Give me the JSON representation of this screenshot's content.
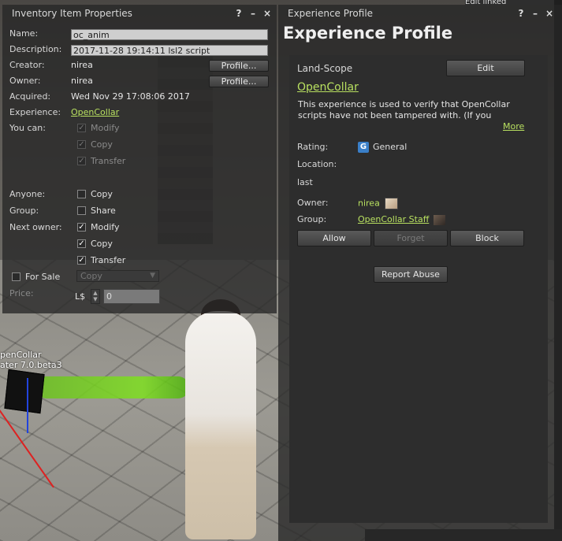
{
  "world": {
    "label_line1": "penCollar",
    "label_line2": "ater 7.0.beta3",
    "top_right_text": "Edit linked"
  },
  "inventory": {
    "title": "Inventory Item Properties",
    "title_buttons": [
      "?",
      "–",
      "×"
    ],
    "name_label": "Name:",
    "name_value": "oc_anim",
    "description_label": "Description:",
    "description_value": "2017-11-28 19:14:11 lsl2 script",
    "creator_label": "Creator:",
    "creator_value": "nirea",
    "creator_profile_btn": "Profile...",
    "owner_label": "Owner:",
    "owner_value": "nirea",
    "owner_profile_btn": "Profile...",
    "acquired_label": "Acquired:",
    "acquired_value": "Wed Nov 29 17:08:06 2017",
    "experience_label": "Experience:",
    "experience_value": "OpenCollar",
    "you_can_label": "You can:",
    "you_can": [
      {
        "label": "Modify",
        "checked": true
      },
      {
        "label": "Copy",
        "checked": true
      },
      {
        "label": "Transfer",
        "checked": true
      }
    ],
    "anyone_label": "Anyone:",
    "anyone_copy": "Copy",
    "group_label": "Group:",
    "group_share": "Share",
    "next_owner_label": "Next owner:",
    "next_owner": [
      {
        "label": "Modify",
        "checked": true
      },
      {
        "label": "Copy",
        "checked": true
      },
      {
        "label": "Transfer",
        "checked": true
      }
    ],
    "for_sale_label": "For Sale",
    "sale_type": "Copy",
    "price_label": "Price:",
    "currency": "L$",
    "price_value": "0"
  },
  "experience": {
    "title": "Experience Profile",
    "title_buttons": [
      "?",
      "–",
      "×"
    ],
    "heading": "Experience Profile",
    "scope": "Land-Scope",
    "edit_btn": "Edit",
    "name": "OpenCollar",
    "description": "This experience is used to verify that OpenCollar scripts have not been tampered with.  (If you",
    "more_link": "More",
    "rating_label": "Rating:",
    "rating_badge": "G",
    "rating_value": "General",
    "location_label": "Location:",
    "location_value": "last",
    "owner_label": "Owner:",
    "owner_value": "nirea",
    "group_label": "Group:",
    "group_value": "OpenCollar Staff",
    "allow_btn": "Allow",
    "forget_btn": "Forget",
    "block_btn": "Block",
    "report_btn": "Report Abuse"
  }
}
